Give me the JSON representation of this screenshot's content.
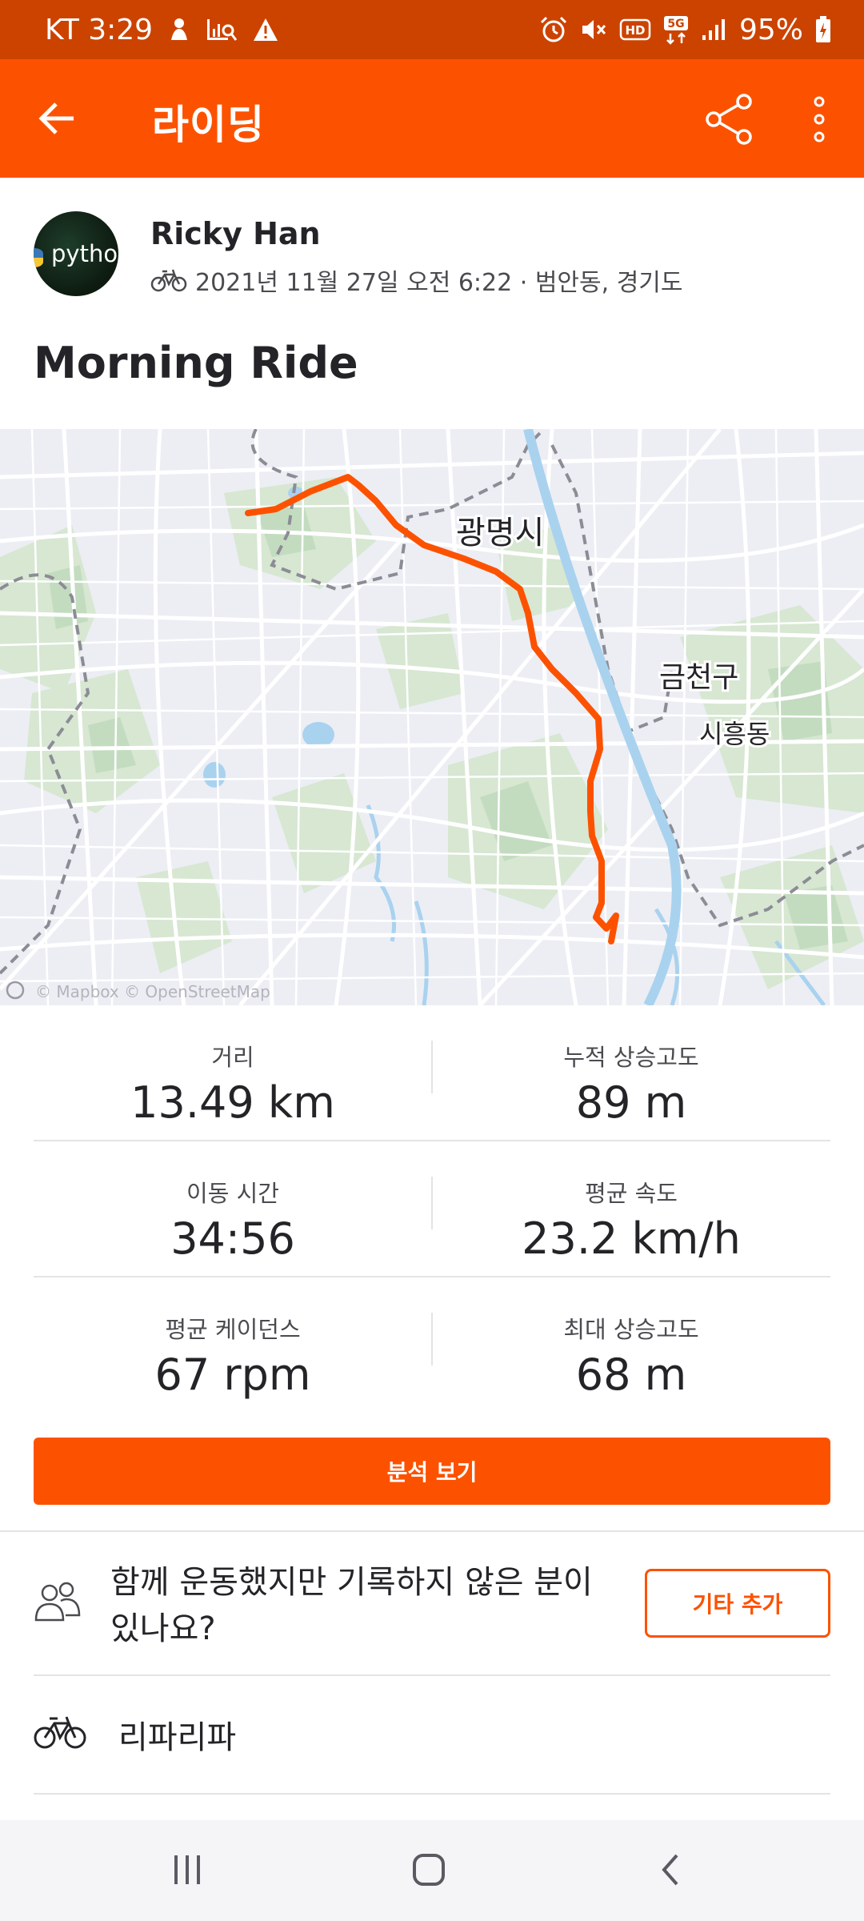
{
  "status_bar": {
    "carrier_time": "KT 3:29",
    "network": "5G",
    "battery": "95%",
    "icons_left": [
      "notification-icon",
      "chart-search-icon",
      "warning-icon"
    ],
    "icons_right": [
      "alarm-icon",
      "mute-icon",
      "hd-icon",
      "5g-icon",
      "signal-icon",
      "battery-icon"
    ]
  },
  "app_bar": {
    "title": "라이딩",
    "back_icon": "arrow-left-icon",
    "share_icon": "share-icon",
    "more_icon": "more-vertical-icon"
  },
  "activity": {
    "athlete": "Ricky Han",
    "avatar_text": "pythor",
    "datetime_location": "2021년 11월 27일 오전 6:22 · 범안동, 경기도",
    "sport_icon": "bike-icon",
    "title": "Morning Ride"
  },
  "map": {
    "labels": {
      "gwangmyeong": "광명시",
      "geumcheon": "금천구",
      "siheung": "시흥동"
    },
    "attribution": "© Mapbox © OpenStreetMap",
    "route_color": "#fc5200"
  },
  "stats": [
    [
      {
        "label": "거리",
        "value": "13.49 km"
      },
      {
        "label": "누적 상승고도",
        "value": "89 m"
      }
    ],
    [
      {
        "label": "이동 시간",
        "value": "34:56"
      },
      {
        "label": "평균 속도",
        "value": "23.2 km/h"
      }
    ],
    [
      {
        "label": "평균 케이던스",
        "value": "67 rpm"
      },
      {
        "label": "최대 상승고도",
        "value": "68 m"
      }
    ]
  ],
  "buttons": {
    "analysis": "분석 보기",
    "add_other": "기타 추가"
  },
  "together": {
    "text": "함께 운동했지만 기록하지 않은 분이 있나요?",
    "icon": "people-icon"
  },
  "gear": {
    "name": "리파리파",
    "icon": "bike-icon"
  },
  "nav": {
    "recents_icon": "recents-icon",
    "home_icon": "home-icon",
    "back_icon": "back-icon"
  },
  "colors": {
    "brand": "#fc5200",
    "status_bar": "#cc4300"
  }
}
